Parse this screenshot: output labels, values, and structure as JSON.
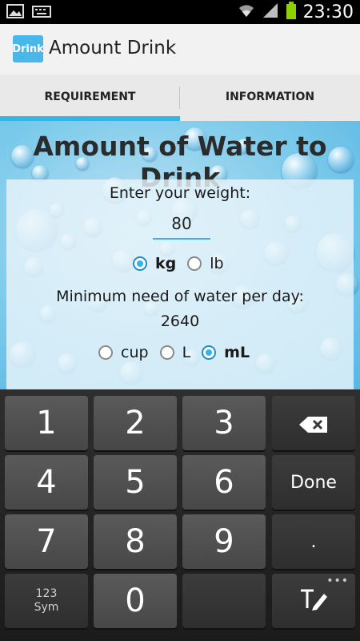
{
  "status_bar": {
    "time": "23:30"
  },
  "action_bar": {
    "icon_text": "Drink",
    "title": "Amount Drink"
  },
  "tabs": [
    {
      "label": "REQUIREMENT",
      "active": true
    },
    {
      "label": "INFORMATION",
      "active": false
    }
  ],
  "main": {
    "heading": "Amount of Water to Drink",
    "weight_prompt": "Enter your weight:",
    "weight_value": "80",
    "weight_units": [
      {
        "label": "kg",
        "selected": true
      },
      {
        "label": "lb",
        "selected": false
      }
    ],
    "need_label": "Minimum need of water per day:",
    "need_value": "2640",
    "volume_units": [
      {
        "label": "cup",
        "selected": false
      },
      {
        "label": "L",
        "selected": false
      },
      {
        "label": "mL",
        "selected": true
      }
    ]
  },
  "keyboard": {
    "keys": [
      "1",
      "2",
      "3",
      "4",
      "5",
      "6",
      "7",
      "8",
      "9",
      "0",
      "."
    ],
    "done_label": "Done",
    "sym_label_1": "123",
    "sym_label_2": "Sym",
    "icons": [
      "backspace-icon",
      "text-mode-icon"
    ]
  },
  "colors": {
    "accent": "#33b5e5",
    "tab_bg": "#e9e9e9",
    "keyboard_bg": "#1f1f1f"
  }
}
